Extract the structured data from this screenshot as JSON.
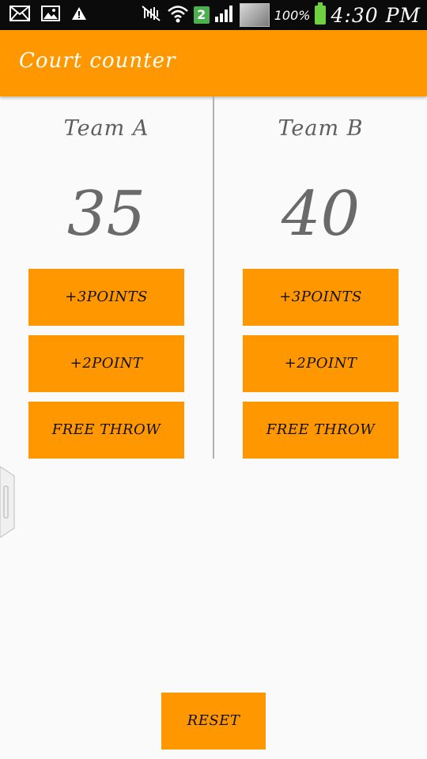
{
  "status_bar": {
    "icons": [
      "mail-icon",
      "image-icon",
      "warning-icon",
      "mute-icon",
      "wifi-icon",
      "sim-2-icon",
      "signal-icon",
      "battery-icon"
    ],
    "sim_badge": "2",
    "battery_percent": "100%",
    "time": "4:30 PM"
  },
  "app": {
    "title": "Court counter",
    "accent_color": "#ff9800"
  },
  "team_a": {
    "name": "Team A",
    "score": "35",
    "btn_three": "+3POINTS",
    "btn_two": "+2POINT",
    "btn_free": "FREE THROW"
  },
  "team_b": {
    "name": "Team B",
    "score": "40",
    "btn_three": "+3POINTS",
    "btn_two": "+2POINT",
    "btn_free": "FREE THROW"
  },
  "reset_label": "RESET"
}
